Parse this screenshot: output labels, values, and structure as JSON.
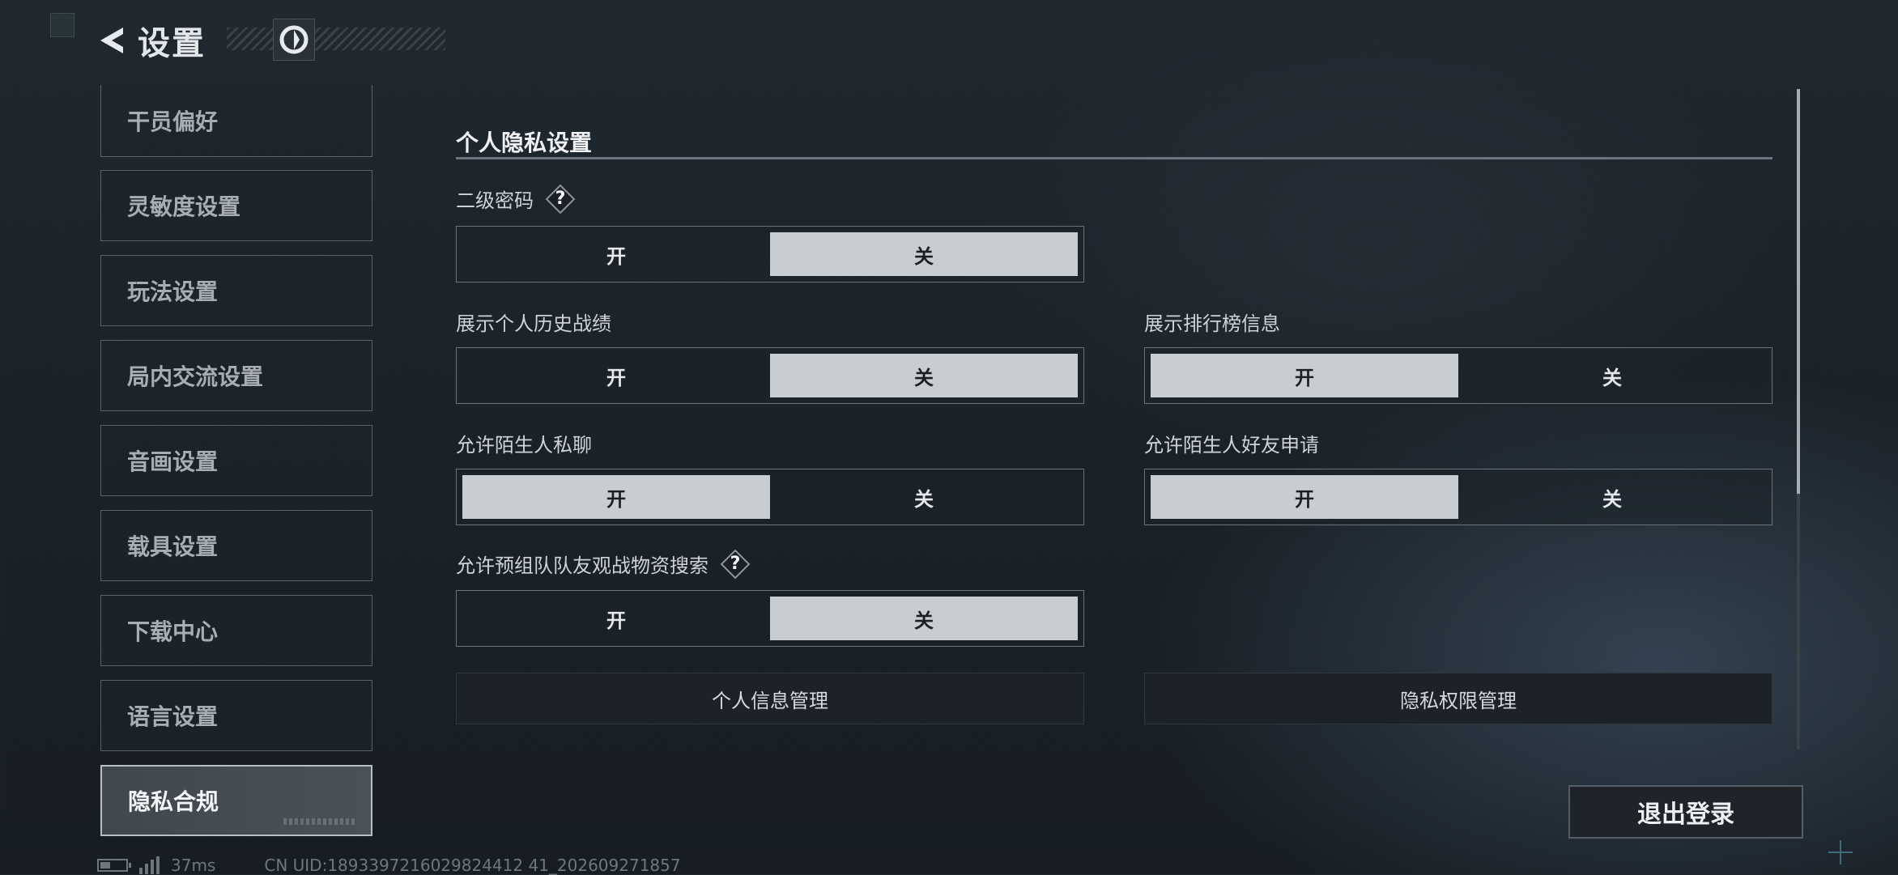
{
  "header": {
    "title": "设置"
  },
  "sidebar": {
    "items": [
      {
        "label": "干员偏好"
      },
      {
        "label": "灵敏度设置"
      },
      {
        "label": "玩法设置"
      },
      {
        "label": "局内交流设置"
      },
      {
        "label": "音画设置"
      },
      {
        "label": "载具设置"
      },
      {
        "label": "下载中心"
      },
      {
        "label": "语言设置"
      },
      {
        "label": "隐私合规",
        "active": true
      }
    ]
  },
  "main": {
    "section_title": "个人隐私设置",
    "settings": [
      {
        "label": "二级密码",
        "has_help": true,
        "on_label": "开",
        "off_label": "关",
        "value": "关"
      },
      {
        "label": "展示个人历史战绩",
        "on_label": "开",
        "off_label": "关",
        "value": "关"
      },
      {
        "label": "展示排行榜信息",
        "on_label": "开",
        "off_label": "关",
        "value": "开"
      },
      {
        "label": "允许陌生人私聊",
        "on_label": "开",
        "off_label": "关",
        "value": "开"
      },
      {
        "label": "允许陌生人好友申请",
        "on_label": "开",
        "off_label": "关",
        "value": "开"
      },
      {
        "label": "允许预组队队友观战物资搜索",
        "has_help": true,
        "on_label": "开",
        "off_label": "关",
        "value": "关"
      }
    ],
    "help_glyph": "?",
    "buttons": {
      "personal_info": "个人信息管理",
      "privacy_permission": "隐私权限管理"
    }
  },
  "logout_label": "退出登录",
  "footer": {
    "ping": "37ms",
    "uid": "CN UID:1893397216029824412 41_202609271857"
  },
  "colors": {
    "selected_option_bg": "#c8cdd1",
    "active_sidebar_border": "#b8bec4"
  }
}
